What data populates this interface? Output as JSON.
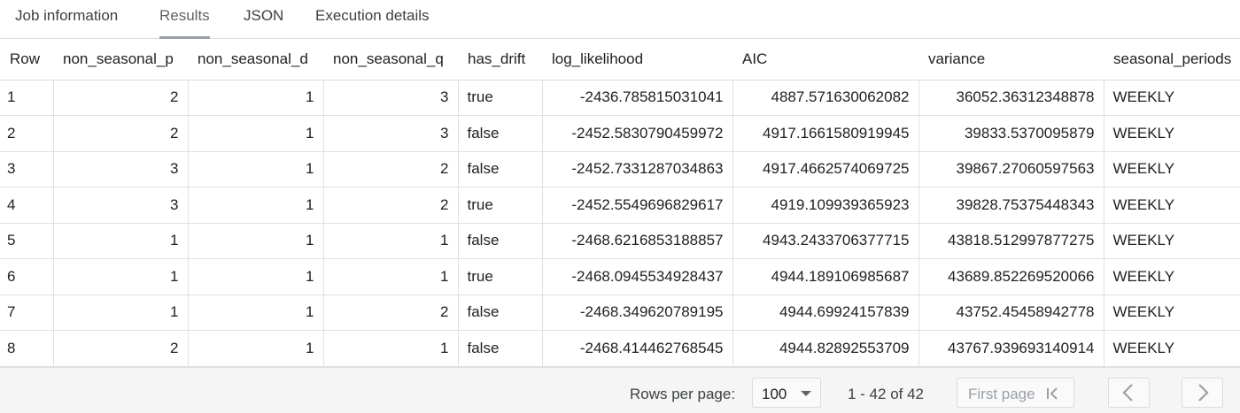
{
  "tabs": [
    {
      "label": "Job information",
      "active": false
    },
    {
      "label": "Results",
      "active": true
    },
    {
      "label": "JSON",
      "active": false
    },
    {
      "label": "Execution details",
      "active": false
    }
  ],
  "table": {
    "columns": [
      "Row",
      "non_seasonal_p",
      "non_seasonal_d",
      "non_seasonal_q",
      "has_drift",
      "log_likelihood",
      "AIC",
      "variance",
      "seasonal_periods"
    ],
    "rows": [
      [
        "1",
        "2",
        "1",
        "3",
        "true",
        "-2436.785815031041",
        "4887.571630062082",
        "36052.36312348878",
        "WEEKLY"
      ],
      [
        "2",
        "2",
        "1",
        "3",
        "false",
        "-2452.5830790459972",
        "4917.1661580919945",
        "39833.5370095879",
        "WEEKLY"
      ],
      [
        "3",
        "3",
        "1",
        "2",
        "false",
        "-2452.7331287034863",
        "4917.4662574069725",
        "39867.27060597563",
        "WEEKLY"
      ],
      [
        "4",
        "3",
        "1",
        "2",
        "true",
        "-2452.5549696829617",
        "4919.109939365923",
        "39828.75375448343",
        "WEEKLY"
      ],
      [
        "5",
        "1",
        "1",
        "1",
        "false",
        "-2468.6216853188857",
        "4943.2433706377715",
        "43818.512997877275",
        "WEEKLY"
      ],
      [
        "6",
        "1",
        "1",
        "1",
        "true",
        "-2468.0945534928437",
        "4944.189106985687",
        "43689.852269520066",
        "WEEKLY"
      ],
      [
        "7",
        "1",
        "1",
        "2",
        "false",
        "-2468.349620789195",
        "4944.69924157839",
        "43752.45458942778",
        "WEEKLY"
      ],
      [
        "8",
        "2",
        "1",
        "1",
        "false",
        "-2468.414462768545",
        "4944.82892553709",
        "43767.939693140914",
        "WEEKLY"
      ]
    ]
  },
  "pagination": {
    "rows_per_page_label": "Rows per page:",
    "rows_per_page_value": "100",
    "range_text": "1 - 42 of 42",
    "first_page_label": "First page"
  },
  "colors": {
    "border": "#dadce0",
    "footer_bg": "#f5f5f5",
    "disabled_text": "#9aa0a6"
  }
}
